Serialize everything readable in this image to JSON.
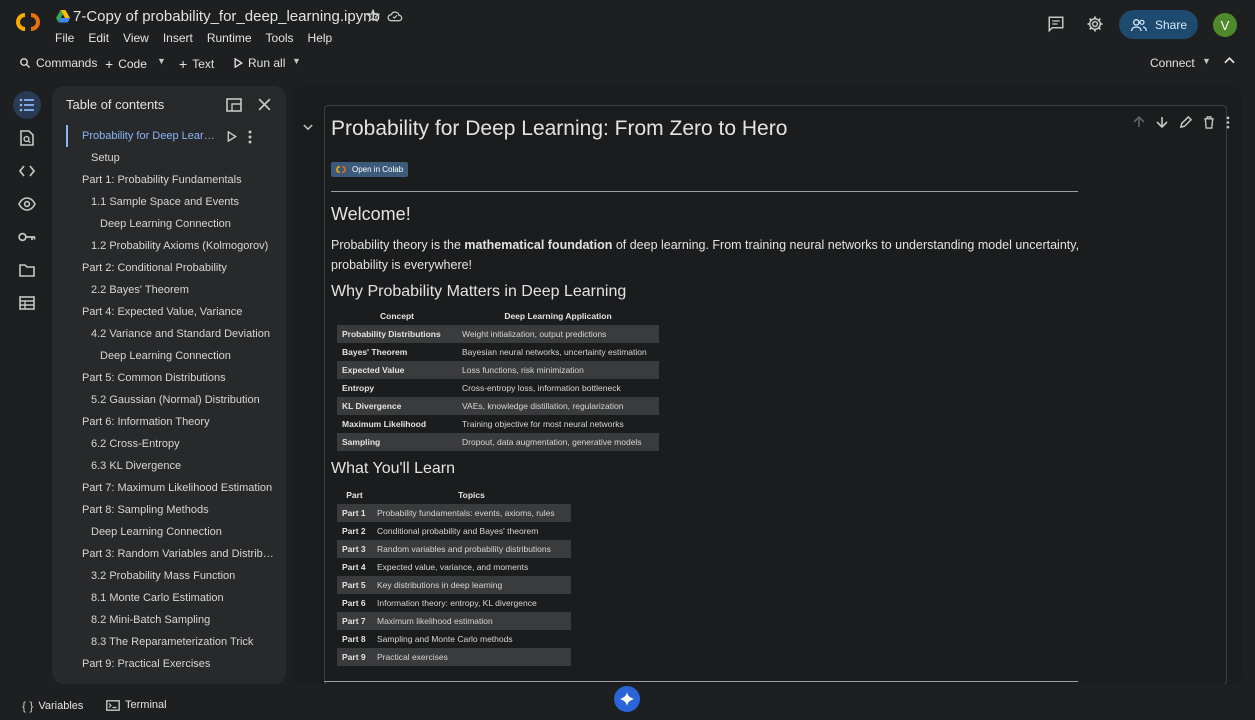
{
  "header": {
    "title": "7-Copy of probability_for_deep_learning.ipynb",
    "menu": [
      "File",
      "Edit",
      "View",
      "Insert",
      "Runtime",
      "Tools",
      "Help"
    ],
    "share_label": "Share",
    "avatar_letter": "V"
  },
  "toolbar": {
    "commands": "Commands",
    "code": "Code",
    "text": "Text",
    "run_all": "Run all",
    "connect": "Connect"
  },
  "toc": {
    "title": "Table of contents",
    "items": [
      {
        "label": "Probability for Deep Learning: From Zero to Hero",
        "level": 1,
        "active": true
      },
      {
        "label": "Setup",
        "level": 2
      },
      {
        "label": "Part 1: Probability Fundamentals",
        "level": 1
      },
      {
        "label": "1.1 Sample Space and Events",
        "level": 2
      },
      {
        "label": "Deep Learning Connection",
        "level": 3
      },
      {
        "label": "1.2 Probability Axioms (Kolmogorov)",
        "level": 2
      },
      {
        "label": "Part 2: Conditional Probability",
        "level": 1
      },
      {
        "label": "2.2 Bayes' Theorem",
        "level": 2
      },
      {
        "label": "Part 4: Expected Value, Variance",
        "level": 1
      },
      {
        "label": "4.2 Variance and Standard Deviation",
        "level": 2
      },
      {
        "label": "Deep Learning Connection",
        "level": 3
      },
      {
        "label": "Part 5: Common Distributions",
        "level": 1
      },
      {
        "label": "5.2 Gaussian (Normal) Distribution",
        "level": 2
      },
      {
        "label": "Part 6: Information Theory",
        "level": 1
      },
      {
        "label": "6.2 Cross-Entropy",
        "level": 2
      },
      {
        "label": "6.3 KL Divergence",
        "level": 2
      },
      {
        "label": "Part 7: Maximum Likelihood Estimation",
        "level": 1
      },
      {
        "label": "Part 8: Sampling Methods",
        "level": 1
      },
      {
        "label": "Deep Learning Connection",
        "level": 2
      },
      {
        "label": "Part 3: Random Variables and Distributions",
        "level": 1
      },
      {
        "label": "3.2 Probability Mass Function",
        "level": 2
      },
      {
        "label": "8.1 Monte Carlo Estimation",
        "level": 2
      },
      {
        "label": "8.2 Mini-Batch Sampling",
        "level": 2
      },
      {
        "label": "8.3 The Reparameterization Trick",
        "level": 2
      },
      {
        "label": "Part 9: Practical Exercises",
        "level": 1
      }
    ]
  },
  "notebook": {
    "h1": "Probability for Deep Learning: From Zero to Hero",
    "badge": "Open in Colab",
    "welcome": "Welcome!",
    "intro_pre": "Probability theory is the ",
    "intro_bold": "mathematical foundation",
    "intro_post": " of deep learning. From training neural networks to understanding model uncertainty, probability is everywhere!",
    "why_heading": "Why Probability Matters in Deep Learning",
    "concept_table": {
      "headers": [
        "Concept",
        "Deep Learning Application"
      ],
      "rows": [
        [
          "Probability Distributions",
          "Weight initialization, output predictions"
        ],
        [
          "Bayes' Theorem",
          "Bayesian neural networks, uncertainty estimation"
        ],
        [
          "Expected Value",
          "Loss functions, risk minimization"
        ],
        [
          "Entropy",
          "Cross-entropy loss, information bottleneck"
        ],
        [
          "KL Divergence",
          "VAEs, knowledge distillation, regularization"
        ],
        [
          "Maximum Likelihood",
          "Training objective for most neural networks"
        ],
        [
          "Sampling",
          "Dropout, data augmentation, generative models"
        ]
      ]
    },
    "learn_heading": "What You'll Learn",
    "parts_table": {
      "headers": [
        "Part",
        "Topics"
      ],
      "rows": [
        [
          "Part 1",
          "Probability fundamentals: events, axioms, rules"
        ],
        [
          "Part 2",
          "Conditional probability and Bayes' theorem"
        ],
        [
          "Part 3",
          "Random variables and probability distributions"
        ],
        [
          "Part 4",
          "Expected value, variance, and moments"
        ],
        [
          "Part 5",
          "Key distributions in deep learning"
        ],
        [
          "Part 6",
          "Information theory: entropy, KL divergence"
        ],
        [
          "Part 7",
          "Maximum likelihood estimation"
        ],
        [
          "Part 8",
          "Sampling and Monte Carlo methods"
        ],
        [
          "Part 9",
          "Practical exercises"
        ]
      ]
    }
  },
  "bottom": {
    "variables": "Variables",
    "terminal": "Terminal"
  }
}
